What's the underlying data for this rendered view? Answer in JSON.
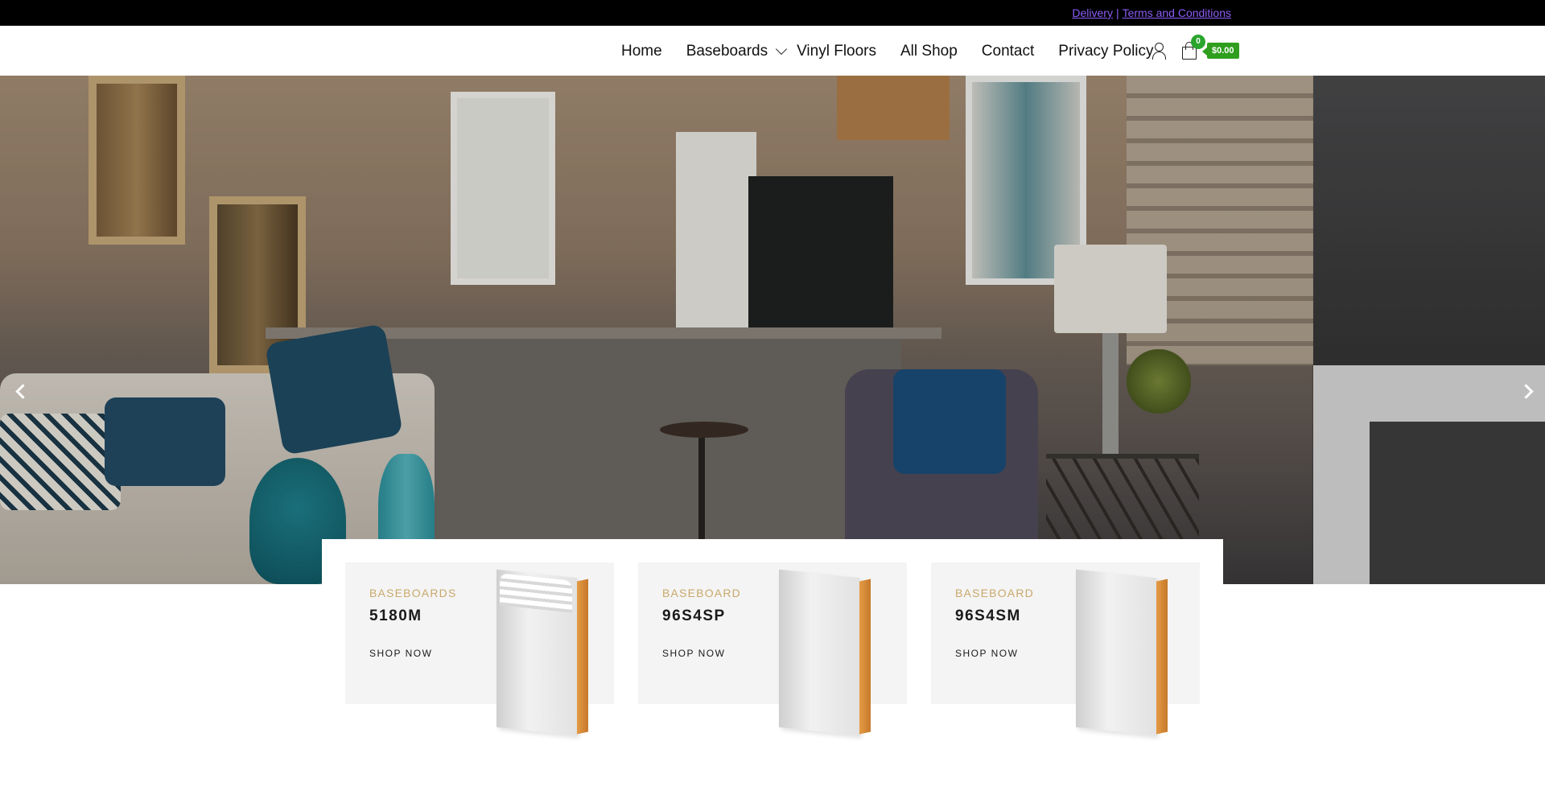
{
  "topbar": {
    "delivery_link": "Delivery",
    "separator": "|",
    "terms_link": "Terms and Conditions"
  },
  "nav": {
    "items": [
      {
        "label": "Home"
      },
      {
        "label": "Baseboards",
        "has_dropdown": true
      },
      {
        "label": "Vinyl Floors"
      },
      {
        "label": "All Shop"
      },
      {
        "label": "Contact"
      },
      {
        "label": "Privacy Policy"
      }
    ],
    "icons": [
      "user-icon",
      "shopping-bag-icon"
    ],
    "cart_count": "0",
    "cart_total": "$0.00"
  },
  "hero": {
    "prev_icon": "chevron-left-icon",
    "next_icon": "chevron-right-icon"
  },
  "products": [
    {
      "category": "BASEBOARDS",
      "name": "5180M",
      "cta": "SHOP NOW"
    },
    {
      "category": "BASEBOARD",
      "name": "96S4SP",
      "cta": "SHOP NOW"
    },
    {
      "category": "BASEBOARD",
      "name": "96S4SM",
      "cta": "SHOP NOW"
    }
  ],
  "colors": {
    "topbar_bg": "#000000",
    "link": "#8a5cf6",
    "cart_badge": "#2f9e1e",
    "category_text": "#c9a86a",
    "card_bg": "#f4f4f4"
  }
}
